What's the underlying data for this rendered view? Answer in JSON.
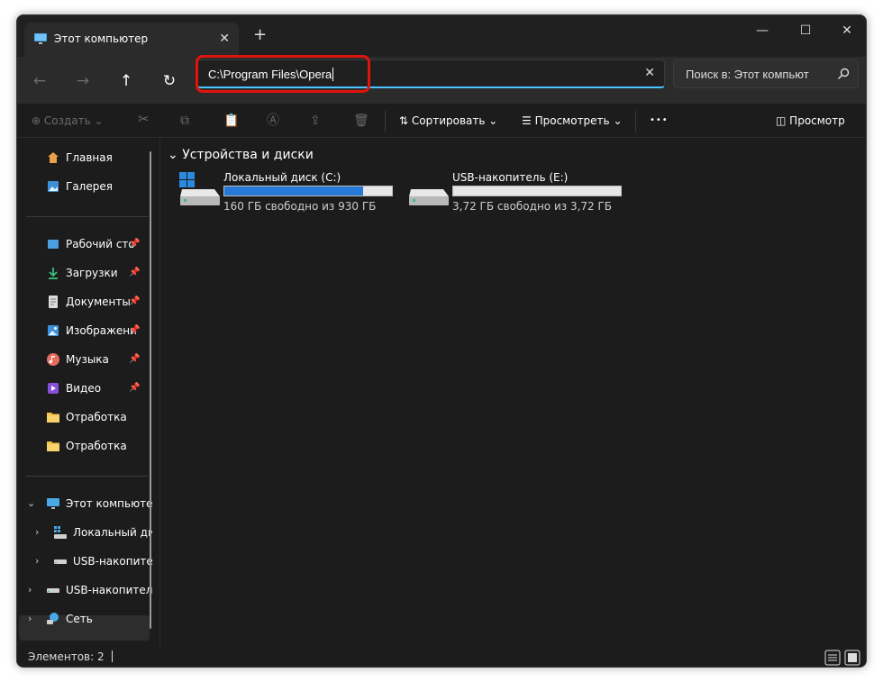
{
  "window": {
    "tab_title": "Этот компьютер",
    "tab_close": "✕",
    "new_tab": "+",
    "minimize": "—",
    "maximize": "☐",
    "close": "✕"
  },
  "nav": {
    "back": "←",
    "forward": "→",
    "up": "↑",
    "refresh": "↻"
  },
  "address": {
    "value": "C:\\Program Files\\Opera",
    "clear": "✕"
  },
  "search": {
    "placeholder": "Поиск в: Этот компьют"
  },
  "toolbar": {
    "create": "Создать",
    "sort": "Сортировать",
    "view": "Просмотреть",
    "more": "•••",
    "preview": "Просмотр"
  },
  "sidebar": {
    "quick": [
      {
        "label": "Главная",
        "icon": "home-icon"
      },
      {
        "label": "Галерея",
        "icon": "gallery-icon"
      }
    ],
    "pinned": [
      {
        "label": "Рабочий сто",
        "icon": "desktop-icon"
      },
      {
        "label": "Загрузки",
        "icon": "downloads-icon"
      },
      {
        "label": "Документы",
        "icon": "documents-icon"
      },
      {
        "label": "Изображени",
        "icon": "pictures-icon"
      },
      {
        "label": "Музыка",
        "icon": "music-icon"
      },
      {
        "label": "Видео",
        "icon": "video-icon"
      },
      {
        "label": "Отработка",
        "icon": "folder-icon"
      },
      {
        "label": "Отработка",
        "icon": "folder-icon"
      }
    ],
    "tree": [
      {
        "label": "Этот компьюте",
        "icon": "this-pc-icon",
        "selected": true
      },
      {
        "label": "Локальный ди",
        "icon": "local-disk-icon"
      },
      {
        "label": "USB-накопите",
        "icon": "usb-drive-icon"
      },
      {
        "label": "USB-накопител",
        "icon": "usb-drive-icon"
      },
      {
        "label": "Сеть",
        "icon": "network-icon"
      }
    ]
  },
  "content": {
    "group_title": "Устройства и диски",
    "drives": [
      {
        "name": "Локальный диск (C:)",
        "free_text": "160 ГБ свободно из 930 ГБ",
        "used_fraction": 0.83,
        "bar_color": "#2679d6",
        "icon": "windows-drive-icon"
      },
      {
        "name": "USB-накопитель (E:)",
        "free_text": "3,72 ГБ свободно из 3,72 ГБ",
        "used_fraction": 0.0,
        "bar_color": "#2679d6",
        "icon": "usb-drive-icon"
      }
    ]
  },
  "status": {
    "items_count": "Элементов: 2"
  },
  "colors": {
    "accent": "#4cc2ff",
    "highlight": "#e0140c",
    "drive_fill": "#2679d6"
  }
}
